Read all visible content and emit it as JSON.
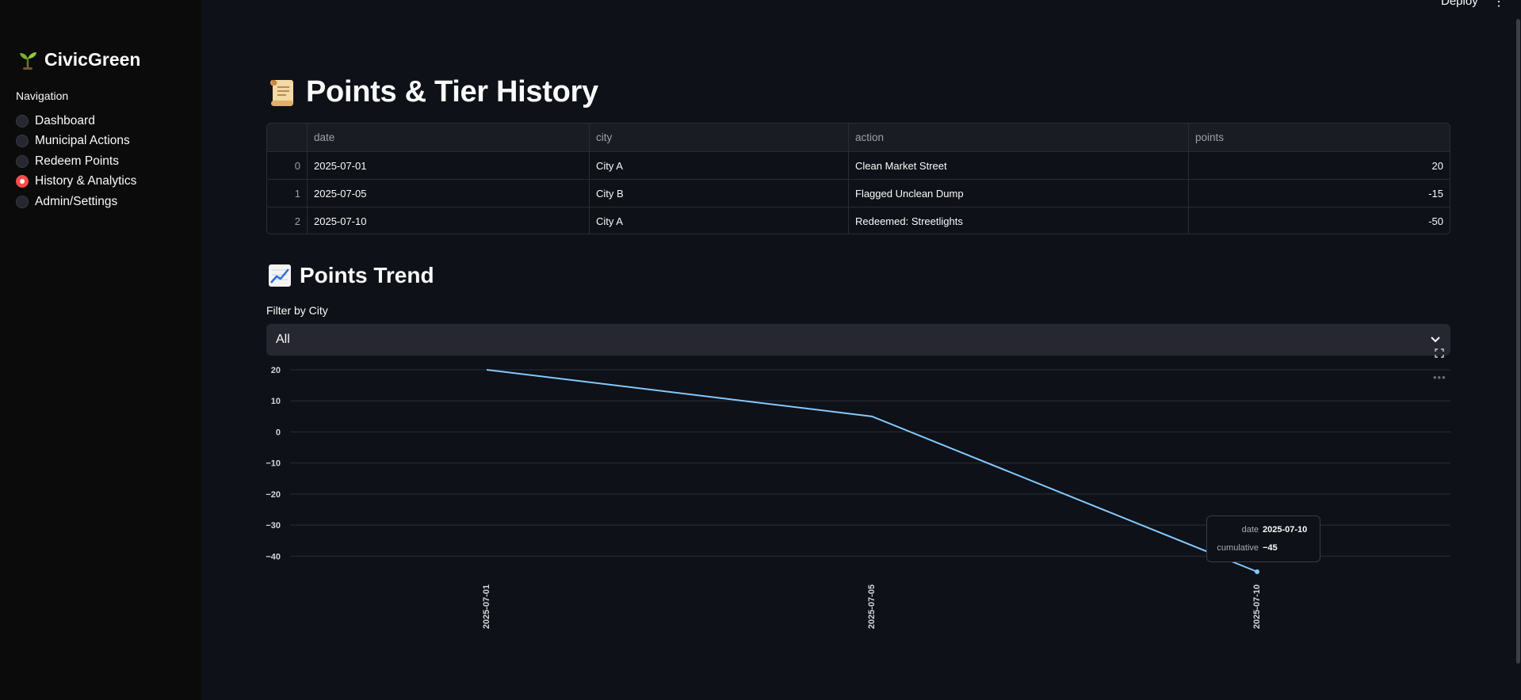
{
  "header": {
    "deploy_label": "Deploy",
    "menu_glyph": "⋮"
  },
  "sidebar": {
    "brand_emoji": "🌱",
    "brand": "CivicGreen",
    "nav_label": "Navigation",
    "items": [
      {
        "label": "Dashboard",
        "selected": false
      },
      {
        "label": "Municipal Actions",
        "selected": false
      },
      {
        "label": "Redeem Points",
        "selected": false
      },
      {
        "label": "History & Analytics",
        "selected": true
      },
      {
        "label": "Admin/Settings",
        "selected": false
      }
    ]
  },
  "main": {
    "title": "Points & Tier History",
    "title_icon": "scroll-icon",
    "table": {
      "columns": [
        "",
        "date",
        "city",
        "action",
        "points"
      ],
      "rows": [
        {
          "idx": "0",
          "date": "2025-07-01",
          "city": "City A",
          "action": "Clean Market Street",
          "points": "20"
        },
        {
          "idx": "1",
          "date": "2025-07-05",
          "city": "City B",
          "action": "Flagged Unclean Dump",
          "points": "-15"
        },
        {
          "idx": "2",
          "date": "2025-07-10",
          "city": "City A",
          "action": "Redeemed: Streetlights",
          "points": "-50"
        }
      ]
    },
    "trend_title": "Points Trend",
    "trend_icon": "chart-increasing-icon",
    "filter": {
      "label": "Filter by City",
      "value": "All"
    }
  },
  "chart_data": {
    "type": "line",
    "x": [
      "2025-07-01",
      "2025-07-05",
      "2025-07-10"
    ],
    "series": [
      {
        "values": [
          20,
          5,
          -45
        ]
      }
    ],
    "ylim": [
      -45,
      20
    ],
    "yticks": [
      20,
      10,
      0,
      -10,
      -20,
      -30,
      -40
    ],
    "grid": true,
    "color": "#83c9ff",
    "tooltip": {
      "date_key": "date",
      "date_value": "2025-07-10",
      "value_key": "cumulative",
      "value_value": "−45"
    }
  }
}
